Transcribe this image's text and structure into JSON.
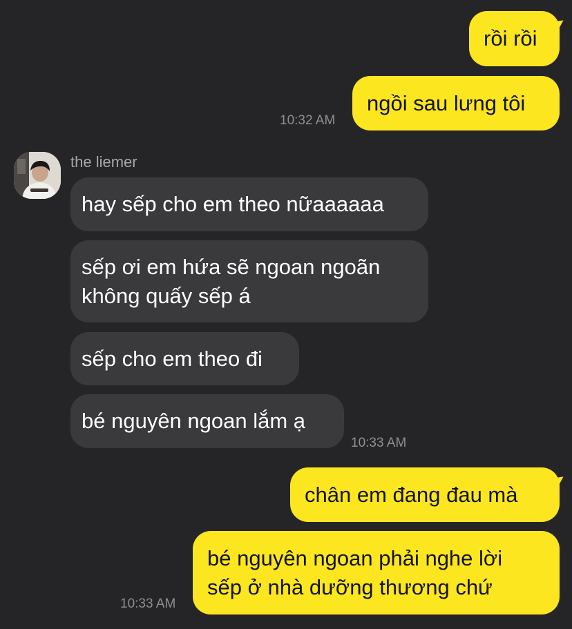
{
  "chat": {
    "contact_name": "the liemer",
    "avatar_label": "avatar",
    "messages": {
      "m1": "rồi rồi",
      "m2": "ngồi sau lưng tôi",
      "t1": "10:32 AM",
      "m3": "hay sếp cho em theo nữaaaaaa",
      "m4": "sếp ơi em hứa sẽ ngoan ngoãn\nkhông quấy sếp á",
      "m5": "sếp cho em theo đi",
      "m6": "bé nguyên ngoan lắm ạ",
      "t2": "10:33 AM",
      "m7": "chân em đang đau mà",
      "m8": "bé nguyên ngoan phải nghe lời\nsếp ở nhà dưỡng thương chứ",
      "t3": "10:33 AM"
    }
  },
  "colors": {
    "background": "#252527",
    "outgoing_bubble": "#fce620",
    "incoming_bubble": "#3a3a3d",
    "timestamp": "#8e8e93"
  }
}
